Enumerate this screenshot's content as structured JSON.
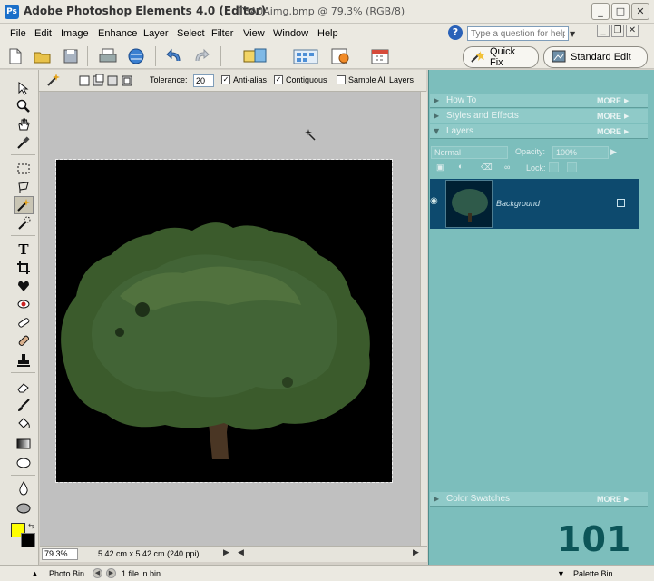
{
  "window": {
    "app_title": "Adobe Photoshop Elements 4.0 (Editor)",
    "doc_title": "T3A0Aimg.bmp @ 79.3% (RGB/8)",
    "buttons": [
      "minimize",
      "maximize",
      "close"
    ]
  },
  "menu": {
    "items": [
      "File",
      "Edit",
      "Image",
      "Enhance",
      "Layer",
      "Select",
      "Filter",
      "View",
      "Window",
      "Help"
    ],
    "help_placeholder": "Type a question for help"
  },
  "shortcuts": {
    "icons": [
      "new-icon",
      "open-icon",
      "save-icon",
      "print-icon",
      "online-services-icon",
      "undo-icon",
      "redo-icon",
      "organizer-icon",
      "photo-browser-icon",
      "create-icon",
      "calendar-icon"
    ],
    "quick_fix_label": "Quick Fix",
    "standard_edit_label": "Standard Edit"
  },
  "options": {
    "tolerance_label": "Tolerance:",
    "tolerance_value": "20",
    "antialias_label": "Anti-alias",
    "antialias_checked": true,
    "contiguous_label": "Contiguous",
    "contiguous_checked": true,
    "sample_all_label": "Sample All Layers",
    "sample_all_checked": false
  },
  "tools": [
    "move-tool",
    "zoom-tool",
    "hand-tool",
    "eyedropper-tool",
    "marquee-tool",
    "lasso-tool",
    "magic-wand-tool",
    "selection-brush-tool",
    "type-tool",
    "crop-tool",
    "cookie-cutter-tool",
    "red-eye-tool",
    "spot-healing-tool",
    "clone-stamp-tool",
    "eraser-tool",
    "brush-tool",
    "paint-bucket-tool",
    "gradient-tool",
    "shape-tool",
    "blur-tool",
    "sponge-tool"
  ],
  "colors": {
    "foreground": "#ffff00",
    "background": "#000000",
    "palette": "#7cbebc",
    "layer_selected": "#0d4a6e"
  },
  "status": {
    "zoom": "79.3%",
    "info": "5.42 cm x 5.42 cm (240 ppi)"
  },
  "bin": {
    "photo_bin_label": "Photo Bin",
    "file_count": "1 file in bin",
    "palette_bin_label": "Palette Bin"
  },
  "palettes": {
    "how_to": "How To",
    "styles_effects": "Styles and Effects",
    "layers": "Layers",
    "color_swatches": "Color Swatches",
    "more": "MORE"
  },
  "layers_panel": {
    "blend_mode": "Normal",
    "opacity_label": "Opacity:",
    "opacity_value": "100%",
    "lock_label": "Lock:",
    "layer_name": "Background"
  },
  "overlay": {
    "score": "101"
  }
}
